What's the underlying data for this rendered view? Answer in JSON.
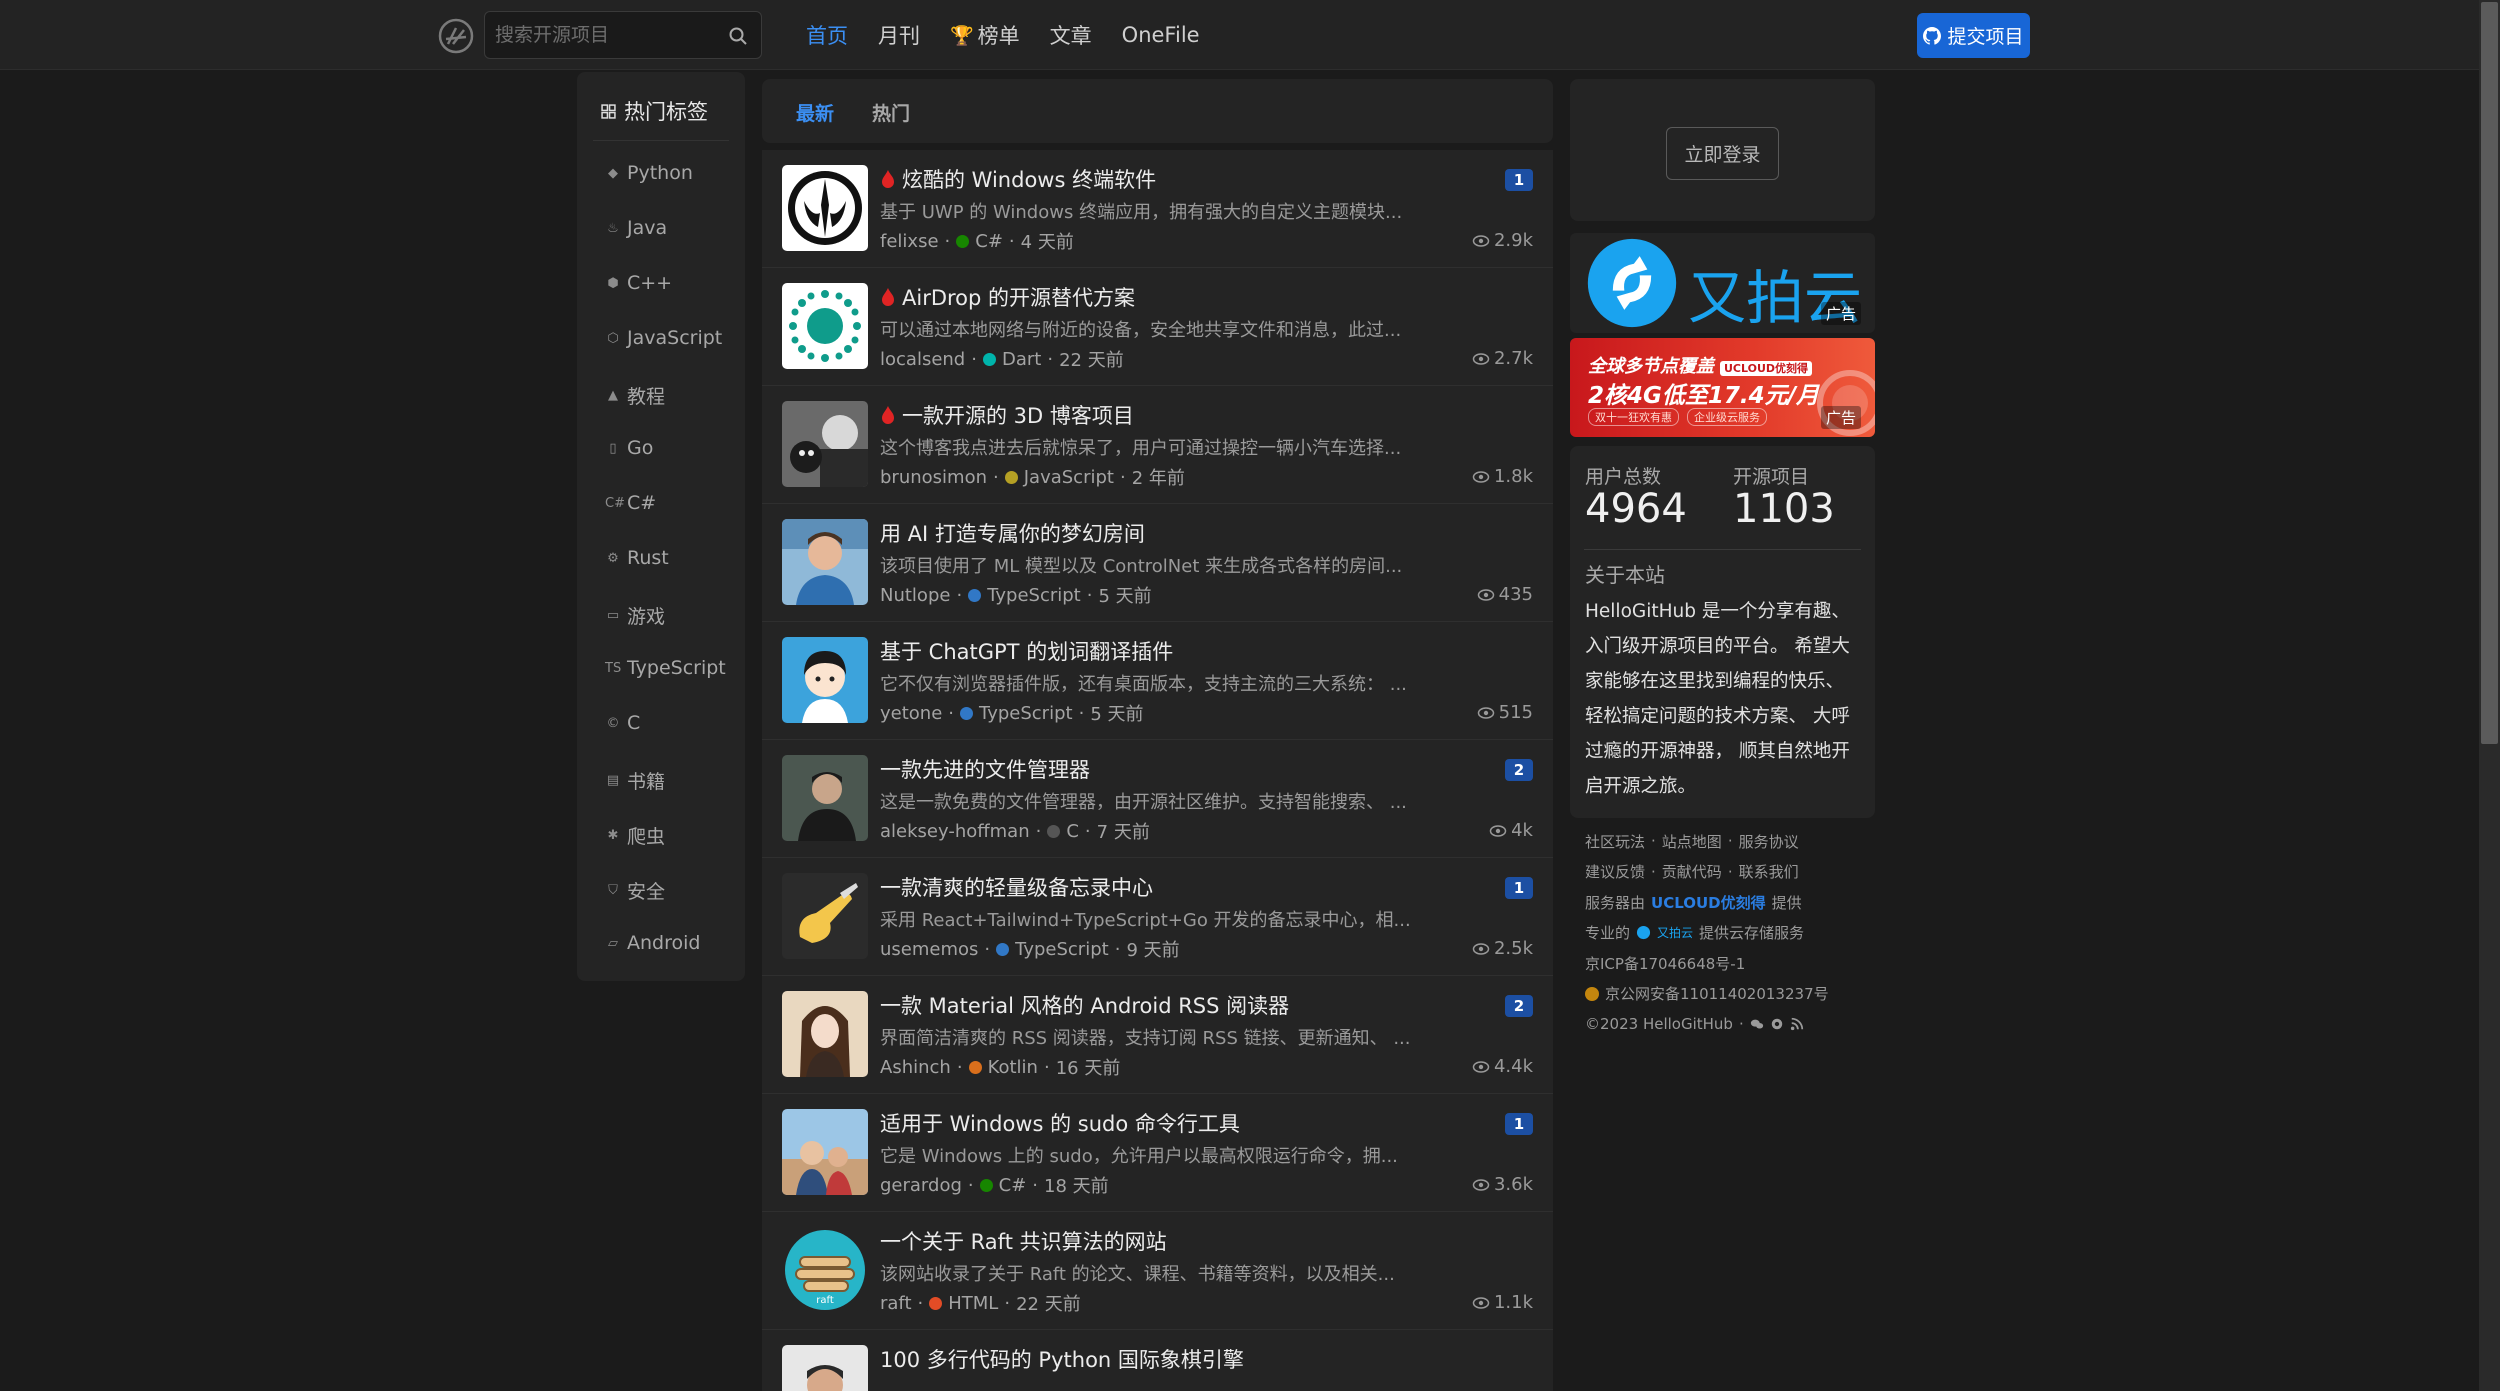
{
  "header": {
    "search_placeholder": "搜索开源项目",
    "nav": [
      {
        "label": "首页",
        "active": true
      },
      {
        "label": "月刊",
        "active": false
      },
      {
        "label": "榜单",
        "active": false,
        "icon": "trophy-icon"
      },
      {
        "label": "文章",
        "active": false
      },
      {
        "label": "OneFile",
        "active": false
      }
    ],
    "submit_label": "提交项目"
  },
  "sidebar": {
    "title": "热门标签",
    "tags": [
      {
        "label": "Python",
        "icon": "python-icon"
      },
      {
        "label": "Java",
        "icon": "java-icon"
      },
      {
        "label": "C++",
        "icon": "cpp-icon"
      },
      {
        "label": "JavaScript",
        "icon": "javascript-icon"
      },
      {
        "label": "教程",
        "icon": "tutorial-icon"
      },
      {
        "label": "Go",
        "icon": "go-icon"
      },
      {
        "label": "C#",
        "icon": "csharp-icon"
      },
      {
        "label": "Rust",
        "icon": "rust-icon"
      },
      {
        "label": "游戏",
        "icon": "game-icon"
      },
      {
        "label": "TypeScript",
        "icon": "typescript-icon"
      },
      {
        "label": "C",
        "icon": "c-icon"
      },
      {
        "label": "书籍",
        "icon": "book-icon"
      },
      {
        "label": "爬虫",
        "icon": "spider-icon"
      },
      {
        "label": "安全",
        "icon": "shield-icon"
      },
      {
        "label": "Android",
        "icon": "android-icon"
      }
    ]
  },
  "feed": {
    "tabs": {
      "latest": "最新",
      "hot": "热门"
    },
    "items": [
      {
        "title": "炫酷的 Windows 终端软件",
        "hot": true,
        "desc": "基于 UWP 的 Windows 终端应用，拥有强大的自定义主题模块...",
        "author": "felixse",
        "lang": "C#",
        "lang_color": "#178600",
        "time": "4 天前",
        "badge": "1",
        "views": "2.9k"
      },
      {
        "title": "AirDrop 的开源替代方案",
        "hot": true,
        "desc": "可以通过本地网络与附近的设备，安全地共享文件和消息，此过...",
        "author": "localsend",
        "lang": "Dart",
        "lang_color": "#00B4AB",
        "time": "22 天前",
        "badge": "",
        "views": "2.7k"
      },
      {
        "title": "一款开源的 3D 博客项目",
        "hot": true,
        "desc": "这个博客我点进去后就惊呆了，用户可通过操控一辆小汽车选择...",
        "author": "brunosimon",
        "lang": "JavaScript",
        "lang_color": "#b5a024",
        "time": "2 年前",
        "badge": "",
        "views": "1.8k"
      },
      {
        "title": "用 AI 打造专属你的梦幻房间",
        "hot": false,
        "desc": "该项目使用了 ML 模型以及 ControlNet 来生成各式各样的房间...",
        "author": "Nutlope",
        "lang": "TypeScript",
        "lang_color": "#3178c6",
        "time": "5 天前",
        "badge": "",
        "views": "435"
      },
      {
        "title": "基于 ChatGPT 的划词翻译插件",
        "hot": false,
        "desc": "它不仅有浏览器插件版，还有桌面版本，支持主流的三大系统： ...",
        "author": "yetone",
        "lang": "TypeScript",
        "lang_color": "#3178c6",
        "time": "5 天前",
        "badge": "",
        "views": "515"
      },
      {
        "title": "一款先进的文件管理器",
        "hot": false,
        "desc": "这是一款免费的文件管理器，由开源社区维护。支持智能搜索、 ...",
        "author": "aleksey-hoffman",
        "lang": "C",
        "lang_color": "#555555",
        "time": "7 天前",
        "badge": "2",
        "views": "4k"
      },
      {
        "title": "一款清爽的轻量级备忘录中心",
        "hot": false,
        "desc": "采用 React+Tailwind+TypeScript+Go 开发的备忘录中心，相...",
        "author": "usememos",
        "lang": "TypeScript",
        "lang_color": "#3178c6",
        "time": "9 天前",
        "badge": "1",
        "views": "2.5k"
      },
      {
        "title": "一款 Material 风格的 Android RSS 阅读器",
        "hot": false,
        "desc": "界面简洁清爽的 RSS 阅读器，支持订阅 RSS 链接、更新通知、 ...",
        "author": "Ashinch",
        "lang": "Kotlin",
        "lang_color": "#d96f1c",
        "time": "16 天前",
        "badge": "2",
        "views": "4.4k"
      },
      {
        "title": "适用于 Windows 的 sudo 命令行工具",
        "hot": false,
        "desc": "它是 Windows 上的 sudo，允许用户以最高权限运行命令，拥...",
        "author": "gerardog",
        "lang": "C#",
        "lang_color": "#178600",
        "time": "18 天前",
        "badge": "1",
        "views": "3.6k"
      },
      {
        "title": "一个关于 Raft 共识算法的网站",
        "hot": false,
        "desc": "该网站收录了关于 Raft 的论文、课程、书籍等资料，以及相关...",
        "author": "raft",
        "lang": "HTML",
        "lang_color": "#e34c26",
        "time": "22 天前",
        "badge": "",
        "views": "1.1k"
      },
      {
        "title": "100 多行代码的 Python 国际象棋引擎",
        "hot": false,
        "desc": "",
        "author": "",
        "lang": "",
        "lang_color": "",
        "time": "",
        "badge": "",
        "views": ""
      }
    ]
  },
  "right": {
    "login_label": "立即登录",
    "ad1": {
      "brand": "又拍云",
      "tag": "广告"
    },
    "ad2": {
      "line1": "全球多节点覆盖",
      "pill": "UCLOUD优刻得",
      "line2": "2核4G低至17.4元/月",
      "chip1": "双十一狂欢有惠",
      "chip2": "企业级云服务",
      "tag": "广告"
    },
    "stats": {
      "users_label": "用户总数",
      "users": "4964",
      "projects_label": "开源项目",
      "projects": "1103"
    },
    "about_title": "关于本站",
    "about_text": "HelloGitHub 是一个分享有趣、 入门级开源项目的平台。 希望大家能够在这里找到编程的快乐、 轻松搞定问题的技术方案、 大呼过瘾的开源神器， 顺其自然地开启开源之旅。"
  },
  "footer": {
    "row1": [
      "社区玩法",
      "站点地图",
      "服务协议"
    ],
    "row2": [
      "建议反馈",
      "贡献代码",
      "联系我们"
    ],
    "server_prefix": "服务器由",
    "server_brand": "UCLOUD优刻得",
    "server_suffix": "提供",
    "storage_prefix": "专业的",
    "storage_brand": "又拍云",
    "storage_suffix": "提供云存储服务",
    "icp": "京ICP备17046648号-1",
    "police": "京公网安备11011402013237号",
    "copyright": "©2023 HelloGitHub"
  }
}
